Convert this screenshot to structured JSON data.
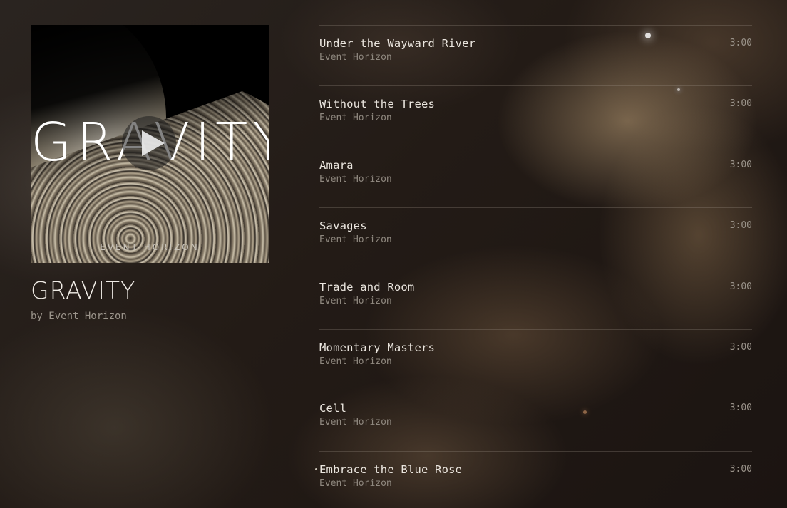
{
  "album": {
    "cover_title": "GRAVITY",
    "cover_artist": "EVENT HORIZON",
    "title": "GRAVITY",
    "byline": "by Event Horizon"
  },
  "tracks": [
    {
      "title": "Under the Wayward River",
      "artist": "Event Horizon",
      "duration": "3:00"
    },
    {
      "title": "Without the Trees",
      "artist": "Event Horizon",
      "duration": "3:00"
    },
    {
      "title": "Amara",
      "artist": "Event Horizon",
      "duration": "3:00"
    },
    {
      "title": "Savages",
      "artist": "Event Horizon",
      "duration": "3:00"
    },
    {
      "title": "Trade and Room",
      "artist": "Event Horizon",
      "duration": "3:00"
    },
    {
      "title": "Momentary Masters",
      "artist": "Event Horizon",
      "duration": "3:00"
    },
    {
      "title": "Cell",
      "artist": "Event Horizon",
      "duration": "3:00"
    },
    {
      "title": "Embrace the Blue Rose",
      "artist": "Event Horizon",
      "duration": "3:00"
    }
  ],
  "icons": {
    "play": "play-icon"
  }
}
